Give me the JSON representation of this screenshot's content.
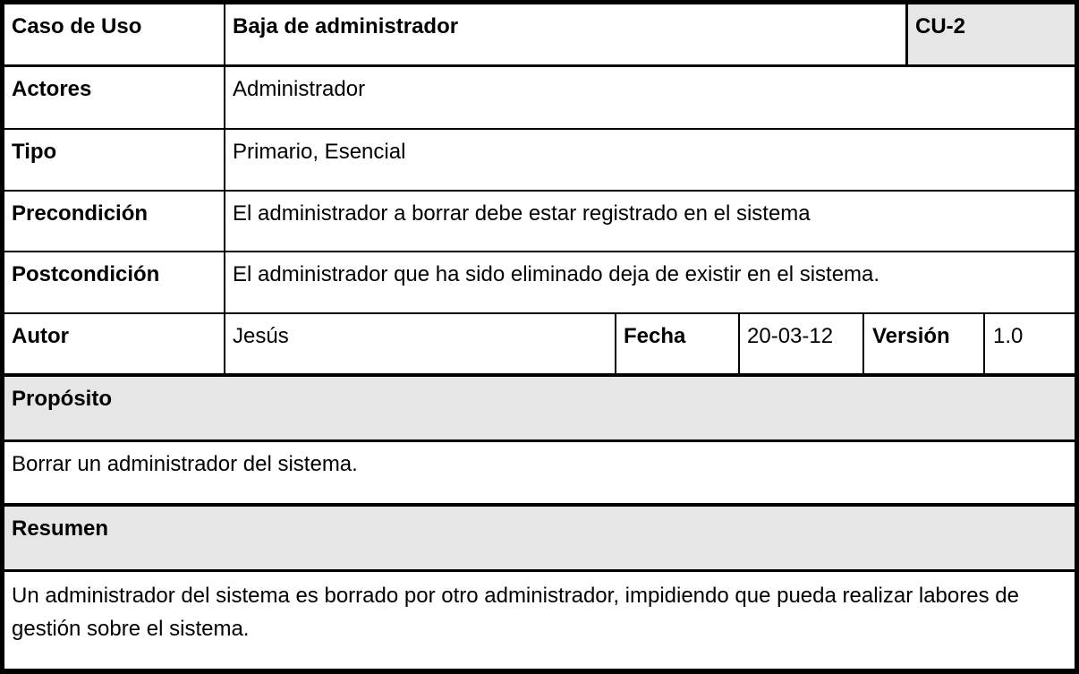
{
  "header": {
    "label": "Caso de Uso",
    "name": "Baja de administrador",
    "code": "CU-2"
  },
  "rows": [
    {
      "label": "Actores",
      "value": "Administrador"
    },
    {
      "label": "Tipo",
      "value": "Primario, Esencial"
    },
    {
      "label": "Precondición",
      "value": "El administrador a borrar debe estar registrado en el sistema"
    },
    {
      "label": "Postcondición",
      "value": "El administrador que ha sido eliminado deja de existir en el sistema."
    }
  ],
  "meta": {
    "author_label": "Autor",
    "author": "Jesús",
    "date_label": "Fecha",
    "date": "20-03-12",
    "version_label": "Versión",
    "version": "1.0"
  },
  "purpose": {
    "label": "Propósito",
    "text": "Borrar un administrador del sistema."
  },
  "summary": {
    "label": "Resumen",
    "text": "Un administrador del sistema es borrado por otro administrador, impidiendo que pueda realizar labores de gestión sobre el sistema."
  },
  "colors": {
    "shade": "#e6e6e6",
    "border": "#000000"
  }
}
